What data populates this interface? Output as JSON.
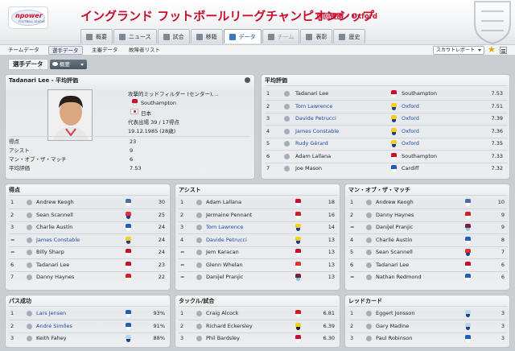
{
  "header": {
    "title": "イングランド フットボールリーグチャンピオンシップ",
    "champion_text": "前回優勝 - Oxford",
    "logo_text": "npower",
    "logo_sub": "FOOTBALL LEAGUE"
  },
  "tabs": [
    {
      "label": "概要",
      "active": false
    },
    {
      "label": "ニュース",
      "active": false
    },
    {
      "label": "試合",
      "active": false
    },
    {
      "label": "移籍",
      "active": false
    },
    {
      "label": "データ",
      "active": true
    },
    {
      "label": "チーム",
      "active": false,
      "disabled": true
    },
    {
      "label": "表彰",
      "active": false
    },
    {
      "label": "歴史",
      "active": false
    }
  ],
  "subnav": [
    {
      "label": "チームデータ",
      "active": false
    },
    {
      "label": "選手データ",
      "active": true
    },
    {
      "label": "主審データ",
      "active": false
    },
    {
      "label": "故障者リスト",
      "active": false
    }
  ],
  "scout_label": "スカウトレポート",
  "section_title": "選手データ",
  "overview_button": "概要",
  "featured": {
    "title": "Tadanari Lee - 平均評価",
    "position": "攻撃的ミッドフィルダー (センター), ..",
    "club": "Southampton",
    "nation": "日本",
    "caps": "代表出場 39 / 17得点",
    "dob": "19.12.1985 (28歳)",
    "stats": [
      {
        "label": "得点",
        "value": "23"
      },
      {
        "label": "アシスト",
        "value": "9"
      },
      {
        "label": "マン・オブ・ザ・マッチ",
        "value": "6"
      },
      {
        "label": "平均評価",
        "value": "7.53"
      }
    ]
  },
  "avg_rating": {
    "title": "平均評価",
    "rows": [
      {
        "rank": "1",
        "name": "Tadanari Lee",
        "link": false,
        "club": "Southampton",
        "club_link": false,
        "value": "7.53"
      },
      {
        "rank": "2",
        "name": "Tom Lawrence",
        "link": true,
        "club": "Oxford",
        "club_link": true,
        "value": "7.51"
      },
      {
        "rank": "3",
        "name": "Davide Petrucci",
        "link": true,
        "club": "Oxford",
        "club_link": true,
        "value": "7.39"
      },
      {
        "rank": "4",
        "name": "James Constable",
        "link": true,
        "club": "Oxford",
        "club_link": true,
        "value": "7.36"
      },
      {
        "rank": "5",
        "name": "Rudy Gérard",
        "link": true,
        "club": "Oxford",
        "club_link": true,
        "value": "7.35"
      },
      {
        "rank": "6",
        "name": "Adam Lallana",
        "link": false,
        "club": "Southampton",
        "club_link": false,
        "value": "7.33"
      },
      {
        "rank": "7",
        "name": "Joe Mason",
        "link": false,
        "club": "Cardiff",
        "club_link": false,
        "value": "7.32"
      }
    ]
  },
  "goals": {
    "title": "得点",
    "rows": [
      {
        "rank": "1",
        "name": "Andrew Keogh",
        "link": false,
        "value": "30"
      },
      {
        "rank": "2",
        "name": "Sean Scannell",
        "link": false,
        "value": "25"
      },
      {
        "rank": "3",
        "name": "Charlie Austin",
        "link": false,
        "value": "24"
      },
      {
        "rank": "=",
        "name": "James Constable",
        "link": true,
        "value": "24"
      },
      {
        "rank": "=",
        "name": "Billy Sharp",
        "link": false,
        "value": "24"
      },
      {
        "rank": "6",
        "name": "Tadanari Lee",
        "link": false,
        "value": "23"
      },
      {
        "rank": "7",
        "name": "Danny Haynes",
        "link": false,
        "value": "22"
      }
    ]
  },
  "assists": {
    "title": "アシスト",
    "rows": [
      {
        "rank": "1",
        "name": "Adam Lallana",
        "link": false,
        "value": "18"
      },
      {
        "rank": "2",
        "name": "Jermaine Pennant",
        "link": false,
        "value": "16"
      },
      {
        "rank": "3",
        "name": "Tom Lawrence",
        "link": true,
        "value": "14"
      },
      {
        "rank": "4",
        "name": "Davide Petrucci",
        "link": true,
        "value": "13"
      },
      {
        "rank": "=",
        "name": "Jem Karacan",
        "link": false,
        "value": "13"
      },
      {
        "rank": "=",
        "name": "Glenn Whelan",
        "link": false,
        "value": "13"
      },
      {
        "rank": "=",
        "name": "Danijel Pranjic",
        "link": false,
        "value": "13"
      }
    ]
  },
  "motm": {
    "title": "マン・オブ・ザ・マッチ",
    "rows": [
      {
        "rank": "1",
        "name": "Andrew Keogh",
        "link": false,
        "value": "10"
      },
      {
        "rank": "2",
        "name": "Danny Haynes",
        "link": false,
        "value": "9"
      },
      {
        "rank": "=",
        "name": "Danijel Pranjic",
        "link": false,
        "value": "9"
      },
      {
        "rank": "4",
        "name": "Charlie Austin",
        "link": false,
        "value": "8"
      },
      {
        "rank": "5",
        "name": "Sean Scannell",
        "link": false,
        "value": "7"
      },
      {
        "rank": "6",
        "name": "Tadanari Lee",
        "link": false,
        "value": "6"
      },
      {
        "rank": "=",
        "name": "Nathan Redmond",
        "link": false,
        "value": "6"
      }
    ]
  },
  "pass": {
    "title": "パス成功",
    "rows": [
      {
        "rank": "1",
        "name": "Lars Jensen",
        "link": true,
        "value": "93%"
      },
      {
        "rank": "2",
        "name": "André Simões",
        "link": true,
        "value": "91%"
      },
      {
        "rank": "3",
        "name": "Keith Fahey",
        "link": false,
        "value": "88%"
      }
    ]
  },
  "tackle": {
    "title": "タックル/試合",
    "rows": [
      {
        "rank": "1",
        "name": "Craig Alcock",
        "link": false,
        "value": "6.81"
      },
      {
        "rank": "2",
        "name": "Richard Eckersley",
        "link": false,
        "value": "6.39"
      },
      {
        "rank": "3",
        "name": "Phil Bardsley",
        "link": false,
        "value": "6.30"
      }
    ]
  },
  "red": {
    "title": "レッドカード",
    "rows": [
      {
        "rank": "1",
        "name": "Eggert Jonsson",
        "link": false,
        "value": "3"
      },
      {
        "rank": "2",
        "name": "Gary Madine",
        "link": false,
        "value": "3"
      },
      {
        "rank": "3",
        "name": "Paul Robinson",
        "link": false,
        "value": "3"
      }
    ]
  },
  "colors": {
    "accent": "#c8102e",
    "link": "#1b4aa5"
  }
}
